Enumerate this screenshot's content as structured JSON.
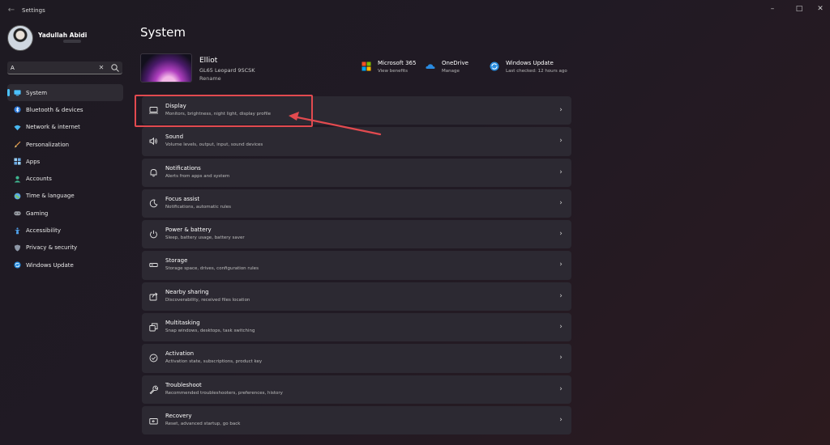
{
  "window": {
    "title": "Settings",
    "controls": {
      "minimize": "–",
      "maximize": "□",
      "close": "✕"
    }
  },
  "profile": {
    "name": "Yadullah Abidi"
  },
  "search": {
    "value": "A",
    "placeholder": "",
    "clear_glyph": "✕"
  },
  "sidebar": {
    "items": [
      {
        "label": "System",
        "icon": "system-icon",
        "active": true
      },
      {
        "label": "Bluetooth & devices",
        "icon": "bluetooth-icon"
      },
      {
        "label": "Network & internet",
        "icon": "wifi-icon"
      },
      {
        "label": "Personalization",
        "icon": "brush-icon"
      },
      {
        "label": "Apps",
        "icon": "apps-icon"
      },
      {
        "label": "Accounts",
        "icon": "accounts-icon"
      },
      {
        "label": "Time & language",
        "icon": "globe-icon"
      },
      {
        "label": "Gaming",
        "icon": "gaming-icon"
      },
      {
        "label": "Accessibility",
        "icon": "accessibility-icon"
      },
      {
        "label": "Privacy & security",
        "icon": "shield-icon"
      },
      {
        "label": "Windows Update",
        "icon": "windows-update-icon"
      }
    ]
  },
  "main": {
    "title": "System",
    "device": {
      "name": "Elliot",
      "model": "GL65 Leopard 9SCSK",
      "rename": "Rename"
    },
    "quick_links": [
      {
        "title": "Microsoft 365",
        "subtitle": "View benefits",
        "icon": "microsoft-365-icon"
      },
      {
        "title": "OneDrive",
        "subtitle": "Manage",
        "icon": "onedrive-icon"
      },
      {
        "title": "Windows Update",
        "subtitle": "Last checked: 12 hours ago",
        "icon": "windows-update-icon"
      }
    ],
    "cards": [
      {
        "title": "Display",
        "subtitle": "Monitors, brightness, night light, display profile",
        "icon": "monitor-icon"
      },
      {
        "title": "Sound",
        "subtitle": "Volume levels, output, input, sound devices",
        "icon": "speaker-icon"
      },
      {
        "title": "Notifications",
        "subtitle": "Alerts from apps and system",
        "icon": "bell-icon"
      },
      {
        "title": "Focus assist",
        "subtitle": "Notifications, automatic rules",
        "icon": "moon-icon"
      },
      {
        "title": "Power & battery",
        "subtitle": "Sleep, battery usage, battery saver",
        "icon": "power-icon"
      },
      {
        "title": "Storage",
        "subtitle": "Storage space, drives, configuration rules",
        "icon": "storage-icon"
      },
      {
        "title": "Nearby sharing",
        "subtitle": "Discoverability, received files location",
        "icon": "share-icon"
      },
      {
        "title": "Multitasking",
        "subtitle": "Snap windows, desktops, task switching",
        "icon": "multitasking-icon"
      },
      {
        "title": "Activation",
        "subtitle": "Activation state, subscriptions, product key",
        "icon": "activation-icon"
      },
      {
        "title": "Troubleshoot",
        "subtitle": "Recommended troubleshooters, preferences, history",
        "icon": "wrench-icon"
      },
      {
        "title": "Recovery",
        "subtitle": "Reset, advanced startup, go back",
        "icon": "recovery-icon"
      }
    ]
  },
  "colors": {
    "accent": "#4cc2ff",
    "annotation": "#e24a4f",
    "card_bg": "#2c2932"
  }
}
